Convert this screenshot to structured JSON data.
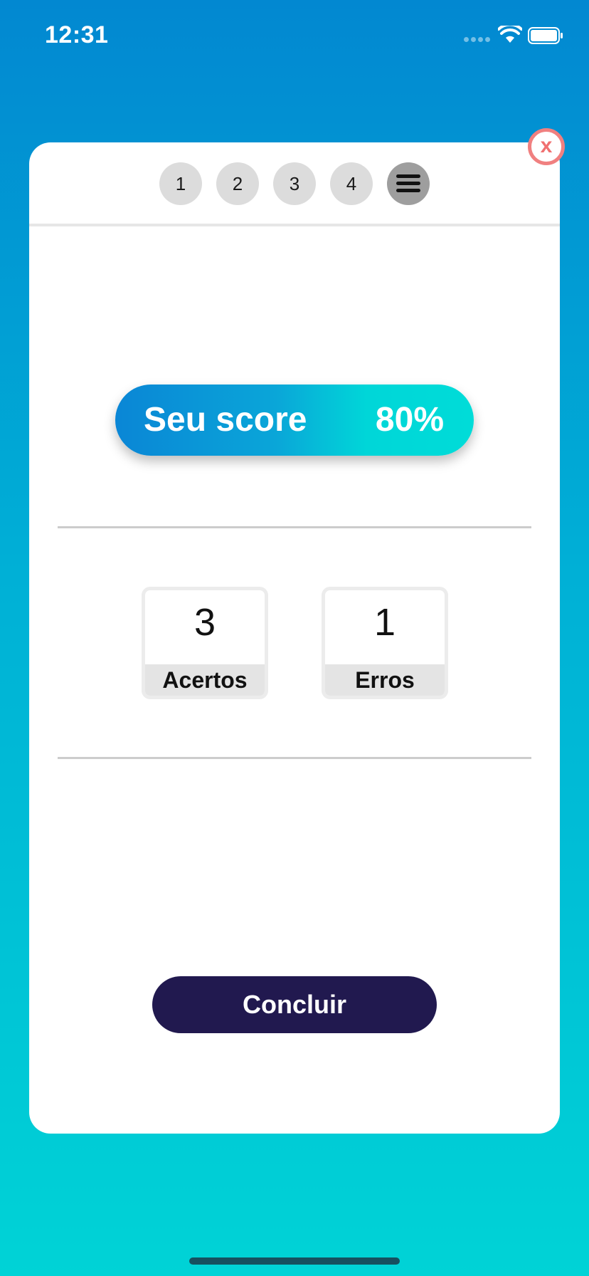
{
  "status_bar": {
    "time": "12:31"
  },
  "close_button": {
    "label": "x"
  },
  "question_nav": {
    "items": [
      {
        "label": "1"
      },
      {
        "label": "2"
      },
      {
        "label": "3"
      },
      {
        "label": "4"
      }
    ],
    "menu_icon": "hamburger-menu-icon"
  },
  "score": {
    "label": "Seu score",
    "value": "80%"
  },
  "stats": {
    "correct": {
      "value": "3",
      "label": "Acertos"
    },
    "wrong": {
      "value": "1",
      "label": "Erros"
    }
  },
  "actions": {
    "finish_label": "Concluir"
  },
  "colors": {
    "background_top": "#0288d1",
    "background_bottom": "#00d3d6",
    "finish_button": "#21194f",
    "close_accent": "#f08080"
  }
}
